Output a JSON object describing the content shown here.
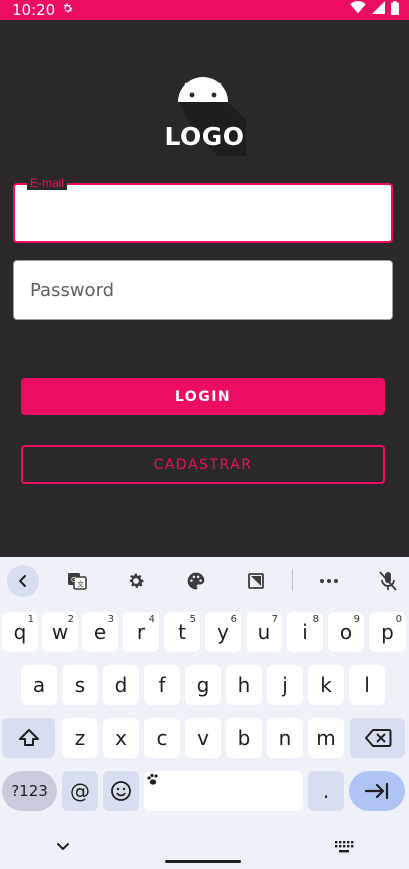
{
  "status": {
    "time": "10:20",
    "icons": [
      "gear-icon",
      "wifi-icon",
      "signal-icon",
      "battery-icon"
    ],
    "bar_color": "#ec0d62"
  },
  "app": {
    "logo_text": "LOGO",
    "email_label": "E-mail",
    "email_value": "",
    "password_placeholder": "Password",
    "password_value": "",
    "login_label": "LOGIN",
    "register_label": "CADASTRAR",
    "accent_color": "#ec0d62",
    "background_color": "#2b2829"
  },
  "keyboard": {
    "toolbar_icons": [
      "chevron-left-icon",
      "translate-icon",
      "gear-icon",
      "palette-icon",
      "clipboard-icon",
      "more-icon",
      "mic-off-icon"
    ],
    "row1": [
      {
        "key": "q",
        "hint": "1"
      },
      {
        "key": "w",
        "hint": "2"
      },
      {
        "key": "e",
        "hint": "3"
      },
      {
        "key": "r",
        "hint": "4"
      },
      {
        "key": "t",
        "hint": "5"
      },
      {
        "key": "y",
        "hint": "6"
      },
      {
        "key": "u",
        "hint": "7"
      },
      {
        "key": "i",
        "hint": "8"
      },
      {
        "key": "o",
        "hint": "9"
      },
      {
        "key": "p",
        "hint": "0"
      }
    ],
    "row2": [
      "a",
      "s",
      "d",
      "f",
      "g",
      "h",
      "j",
      "k",
      "l"
    ],
    "row3": [
      "z",
      "x",
      "c",
      "v",
      "b",
      "n",
      "m"
    ],
    "symbols_label": "?123",
    "at_label": "@",
    "period_label": "."
  }
}
